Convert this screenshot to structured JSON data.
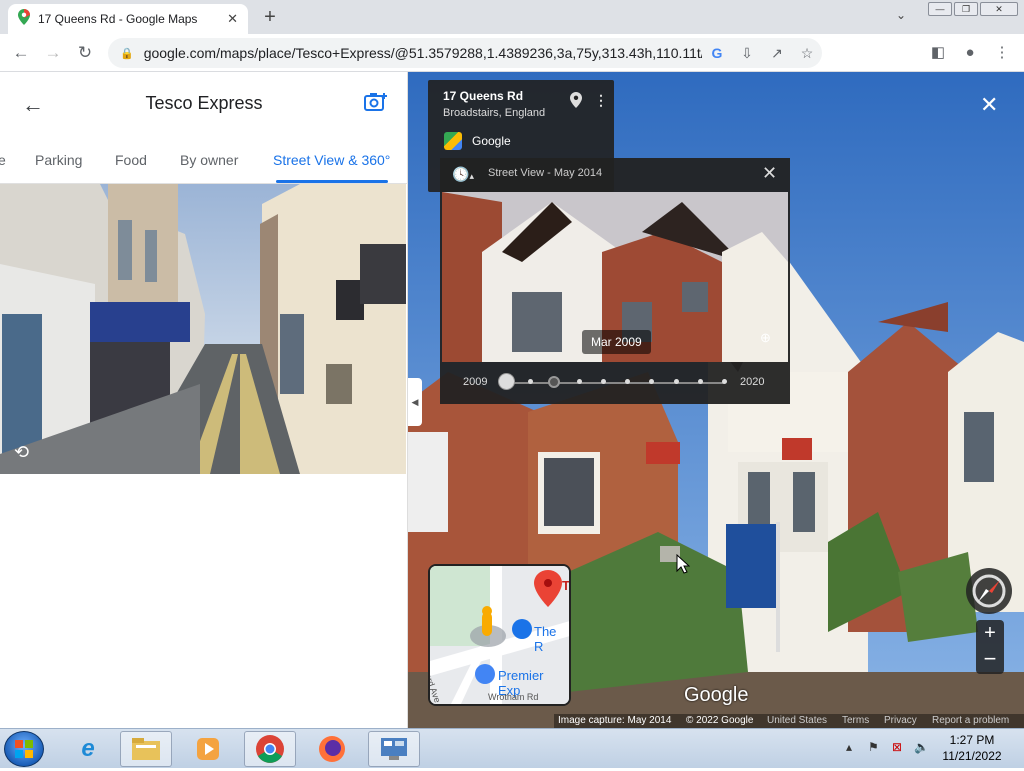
{
  "browser": {
    "tab_title": "17 Queens Rd - Google Maps",
    "url": "google.com/maps/place/Tesco+Express/@51.3579288,1.4389236,3a,75y,313.43h,110.11t/data=!3m7!1..."
  },
  "place_panel": {
    "title": "Tesco Express",
    "tabs": [
      {
        "label": "e"
      },
      {
        "label": "Parking"
      },
      {
        "label": "Food"
      },
      {
        "label": "By owner"
      },
      {
        "label": "Street View & 360°",
        "active": true
      }
    ]
  },
  "street_view": {
    "address_line1": "17 Queens Rd",
    "address_line2": "Broadstairs, England",
    "provider": "Google",
    "time_machine": {
      "label": "Street View - May 2014",
      "preview_date": "Mar 2009",
      "start_year": "2009",
      "end_year": "2020",
      "stops": 10,
      "selected_index": 2
    },
    "minimap": {
      "labels": [
        "The R",
        "Premier Exp",
        "ward Ave",
        "Wrotham Rd",
        "T"
      ]
    },
    "watermark": "Google",
    "footer": {
      "capture": "Image capture: May 2014",
      "copyright": "© 2022 Google",
      "links": [
        "United States",
        "Terms",
        "Privacy",
        "Report a problem"
      ]
    }
  },
  "taskbar": {
    "time": "1:27 PM",
    "date": "11/21/2022"
  },
  "colors": {
    "accent": "#1a73e8",
    "dark_overlay": "#222222",
    "map_pin": "#ea4335"
  }
}
